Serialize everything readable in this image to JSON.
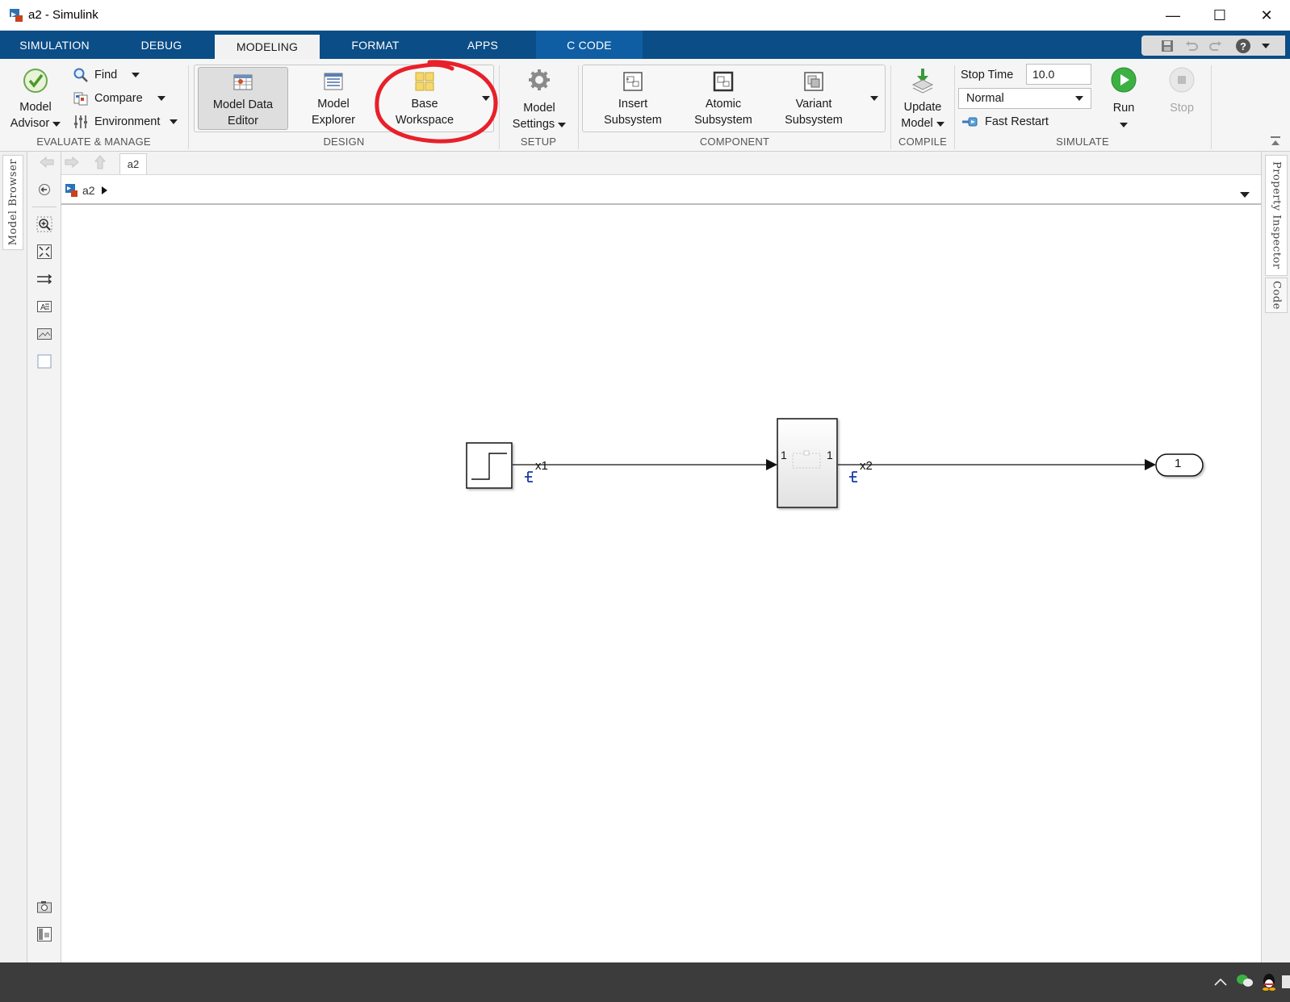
{
  "window": {
    "title": "a2 - Simulink",
    "controls": [
      "—",
      "☐",
      "✕"
    ]
  },
  "tabs": [
    {
      "label": "SIMULATION"
    },
    {
      "label": "DEBUG"
    },
    {
      "label": "MODELING"
    },
    {
      "label": "FORMAT"
    },
    {
      "label": "APPS"
    },
    {
      "label": "C CODE"
    }
  ],
  "ribbon": {
    "evaluate": {
      "section_label": "EVALUATE & MANAGE",
      "model_advisor": [
        "Model",
        "Advisor"
      ],
      "find": "Find",
      "compare": "Compare",
      "environment": "Environment"
    },
    "design": {
      "section_label": "DESIGN",
      "model_data_editor": [
        "Model Data",
        "Editor"
      ],
      "model_explorer": [
        "Model",
        "Explorer"
      ],
      "base_workspace": [
        "Base",
        "Workspace"
      ]
    },
    "setup": {
      "section_label": "SETUP",
      "model_settings": [
        "Model",
        "Settings"
      ]
    },
    "component": {
      "section_label": "COMPONENT",
      "insert_subsystem": [
        "Insert",
        "Subsystem"
      ],
      "atomic_subsystem": [
        "Atomic",
        "Subsystem"
      ],
      "variant_subsystem": [
        "Variant",
        "Subsystem"
      ]
    },
    "compile": {
      "section_label": "COMPILE",
      "update_model": [
        "Update",
        "Model"
      ]
    },
    "simulate": {
      "section_label": "SIMULATE",
      "stop_time_label": "Stop Time",
      "stop_time_value": "10.0",
      "mode": "Normal",
      "fast_restart": "Fast Restart",
      "run": "Run",
      "stop": "Stop"
    }
  },
  "side_panels": {
    "left": "Model Browser",
    "right_1": "Property Inspector",
    "right_2": "Code"
  },
  "navigation": {
    "tab": "a2",
    "breadcrumb": "a2"
  },
  "diagram": {
    "signal_1": "x1",
    "signal_2": "x2",
    "subsystem_in_port": "1",
    "subsystem_out_port": "1",
    "outport_number": "1"
  },
  "colors": {
    "tab_strip": "#0b4d86",
    "annotation_circle": "#e8202a",
    "run_green": "#3cb043"
  }
}
